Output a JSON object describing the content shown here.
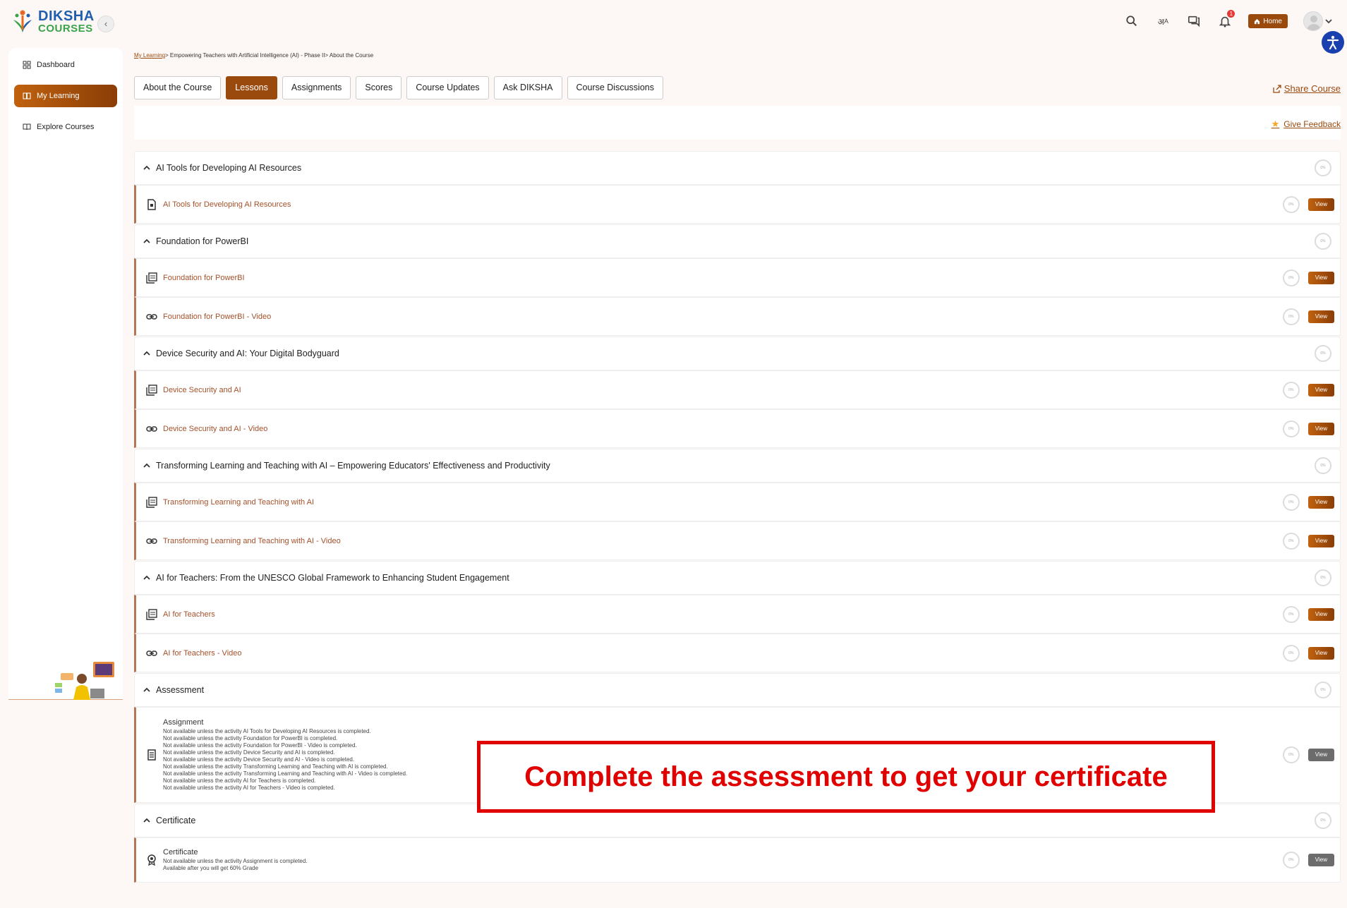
{
  "logo": {
    "line1": "DIKSHA",
    "line2": "COURSES"
  },
  "topbar": {
    "home_label": "Home",
    "notification_count": "1",
    "language_glyph": "अ",
    "language_glyph2": "A"
  },
  "sidebar": {
    "items": [
      {
        "label": "Dashboard",
        "icon": "dashboard-icon",
        "active": false
      },
      {
        "label": "My Learning",
        "icon": "book-icon",
        "active": true
      },
      {
        "label": "Explore Courses",
        "icon": "open-book-icon",
        "active": false
      }
    ]
  },
  "breadcrumb": {
    "link": "My Learning",
    "rest": "> Empowering Teachers with Artificial Intelligence (AI) - Phase II> About the Course"
  },
  "tabs": [
    {
      "label": "About the Course",
      "active": false
    },
    {
      "label": "Lessons",
      "active": true
    },
    {
      "label": "Assignments",
      "active": false
    },
    {
      "label": "Scores",
      "active": false
    },
    {
      "label": "Course Updates",
      "active": false
    },
    {
      "label": "Ask DIKSHA",
      "active": false
    },
    {
      "label": "Course Discussions",
      "active": false
    }
  ],
  "share_label": "Share Course",
  "feedback_label": "Give Feedback",
  "progress_label": "0%",
  "view_label": "View",
  "units": [
    {
      "title": "AI Tools for Developing AI Resources",
      "lessons": [
        {
          "title": "AI Tools for Developing AI Resources",
          "icon": "document-icon"
        }
      ]
    },
    {
      "title": "Foundation for PowerBI",
      "lessons": [
        {
          "title": "Foundation for PowerBI",
          "icon": "pdf-icon"
        },
        {
          "title": "Foundation for PowerBI - Video",
          "icon": "link-icon"
        }
      ]
    },
    {
      "title": "Device Security and AI: Your Digital Bodyguard",
      "lessons": [
        {
          "title": "Device Security and AI",
          "icon": "pdf-icon"
        },
        {
          "title": "Device Security and AI - Video",
          "icon": "link-icon"
        }
      ]
    },
    {
      "title": "Transforming Learning and Teaching with AI – Empowering Educators' Effectiveness and Productivity",
      "lessons": [
        {
          "title": "Transforming Learning and Teaching with AI",
          "icon": "pdf-icon"
        },
        {
          "title": "Transforming Learning and Teaching with AI - Video",
          "icon": "link-icon"
        }
      ]
    },
    {
      "title": "AI for Teachers: From the UNESCO Global Framework to Enhancing Student Engagement",
      "lessons": [
        {
          "title": "AI for Teachers",
          "icon": "pdf-icon"
        },
        {
          "title": "AI for Teachers - Video",
          "icon": "link-icon"
        }
      ]
    }
  ],
  "assessment": {
    "title": "Assessment",
    "activity_title": "Assignment",
    "notes": [
      "Not available unless the activity AI Tools for Developing AI Resources is completed.",
      "Not available unless the activity Foundation for PowerBI is completed.",
      "Not available unless the activity Foundation for PowerBI - Video is completed.",
      "Not available unless the activity Device Security and AI is completed.",
      "Not available unless the activity Device Security and AI - Video is completed.",
      "Not available unless the activity Transforming Learning and Teaching with AI is completed.",
      "Not available unless the activity Transforming Learning and Teaching with AI - Video is completed.",
      "Not available unless the activity AI for Teachers is completed.",
      "Not available unless the activity AI for Teachers - Video is completed."
    ]
  },
  "certificate": {
    "title": "Certificate",
    "activity_title": "Certificate",
    "notes": [
      "Not available unless the activity Assignment is completed.",
      "Available after you will get 60% Grade"
    ]
  },
  "callout": "Complete the assessment to get your certificate",
  "colors": {
    "brand": "#9b4a0e",
    "link": "#a5512a",
    "callout": "#e00000"
  }
}
